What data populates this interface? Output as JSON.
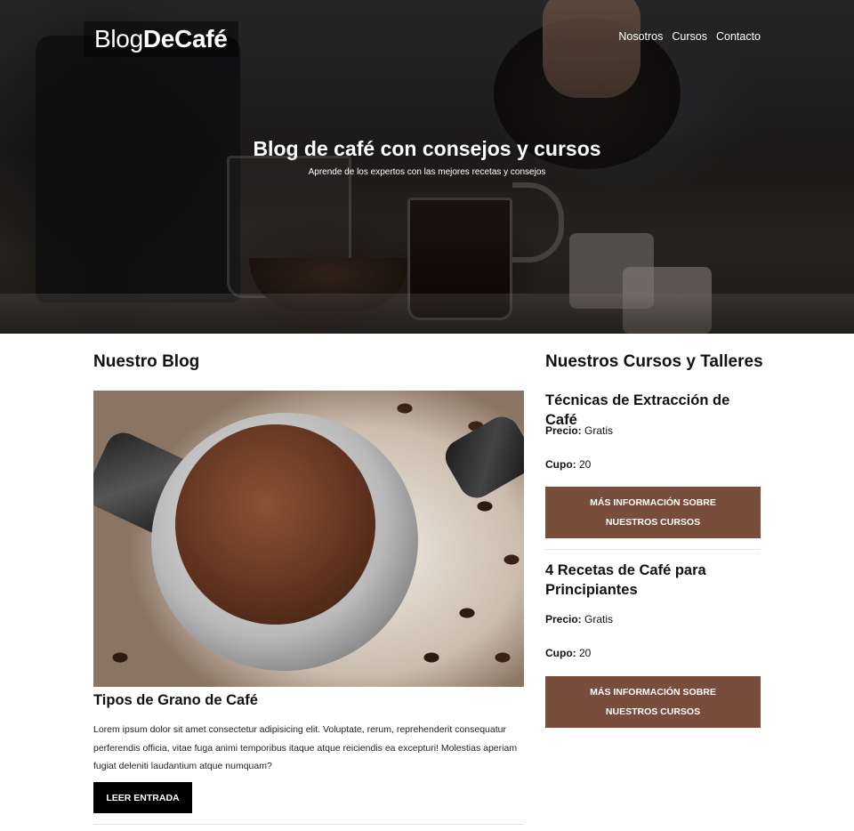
{
  "header": {
    "logo_light": "Blog",
    "logo_bold": "DeCafé",
    "nav": [
      "Nosotros",
      "Cursos",
      "Contacto"
    ],
    "hero_title": "Blog de café con consejos y cursos",
    "hero_subtitle": "Aprende de los expertos con las mejores recetas y consejos"
  },
  "blog": {
    "section_title": "Nuestro Blog",
    "posts": [
      {
        "title": "Tipos de Grano de Café",
        "body": "Lorem ipsum dolor sit amet consectetur adipisicing elit. Voluptate, rerum, reprehenderit consequatur perferendis officia, vitae fuga animi temporibus itaque atque reiciendis ea excepturi! Molestias aperiam fugiat deleniti laudantium atque numquam?",
        "button": "Leer Entrada"
      }
    ]
  },
  "courses": {
    "section_title": "Nuestros Cursos y Talleres",
    "price_label": "Precio:",
    "seats_label": "Cupo:",
    "items": [
      {
        "title": "Técnicas de Extracción de Café",
        "price": "Gratis",
        "seats": "20",
        "button": "Más Información sobre Nuestros Cursos"
      },
      {
        "title": "4 Recetas de Café para Principiantes",
        "price": "Gratis",
        "seats": "20",
        "button": "Más Información sobre Nuestros Cursos"
      }
    ]
  },
  "colors": {
    "button_brown": "#784d3c",
    "button_black": "#000000"
  }
}
